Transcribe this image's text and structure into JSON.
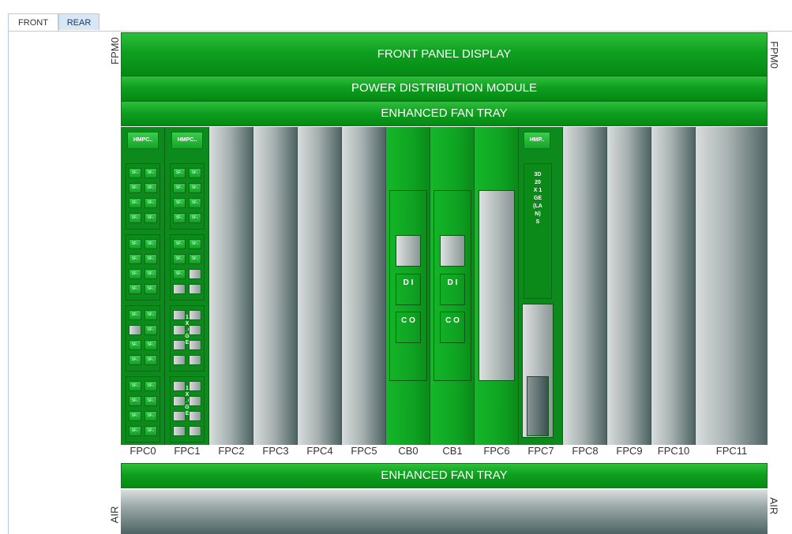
{
  "tabs": [
    {
      "label": "FRONT",
      "active": true
    },
    {
      "label": "REAR",
      "active": false
    }
  ],
  "side_labels": {
    "top_left": "FPM0",
    "top_right": "FPM0",
    "bottom_left": "AIR",
    "bottom_right": "AIR"
  },
  "bars": {
    "front_panel": "FRONT PANEL DISPLAY",
    "power": "POWER DISTRIBUTION MODULE",
    "fan_top": "ENHANCED FAN TRAY",
    "fan_bottom": "ENHANCED FAN TRAY"
  },
  "slots": [
    "FPC0",
    "FPC1",
    "FPC2",
    "FPC3",
    "FPC4",
    "FPC5",
    "CB0",
    "CB1",
    "FPC6",
    "FPC7",
    "FPC8",
    "FPC9",
    "FPC10",
    "FPC11"
  ],
  "modules": {
    "fpc0_chip": "HMPC..",
    "fpc1_chip": "HMPC..",
    "fpc7_chip": "HMP..",
    "sfp_label": "SF..",
    "fpc7_pic_text": "3D 20X 1GE(LAN) S",
    "fpc1_pic_text": "1 X 1 0 G E",
    "cb_di": "D I",
    "cb_co": "C O"
  },
  "colors": {
    "accent_green": "#0fa020",
    "tab_inactive": "#d9e6f4",
    "empty_slot": "#a9b2b2"
  }
}
